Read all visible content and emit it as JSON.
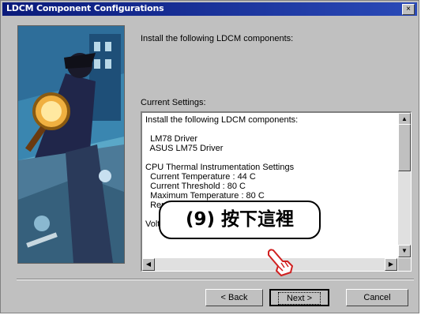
{
  "window": {
    "title": "LDCM Component Configurations",
    "close_glyph": "×"
  },
  "heading": "Install the following LDCM components:",
  "current_settings_label": "Current Settings:",
  "settings_lines": [
    "Install the following LDCM components:",
    "",
    "  LM78 Driver",
    "  ASUS LM75 Driver",
    "",
    "CPU Thermal Instrumentation Settings",
    "  Current Temperature : 44 C",
    "  Current Threshold : 80 C",
    "  Maximum Temperature : 80 C",
    "  Report Events",
    "",
    "Voltage Information"
  ],
  "callout": "(9)  按下這裡",
  "buttons": {
    "back": "< Back",
    "next": "Next >",
    "cancel": "Cancel"
  },
  "icons": {
    "close": "close-icon",
    "scroll_up": "arrow-up-icon",
    "scroll_down": "arrow-down-icon",
    "scroll_left": "arrow-left-icon",
    "scroll_right": "arrow-right-icon",
    "hand": "pointing-hand-icon"
  },
  "colors": {
    "titlebar": "#0a1a7a",
    "face": "#c0c0c0",
    "art_bg": "#5aa8c8"
  }
}
